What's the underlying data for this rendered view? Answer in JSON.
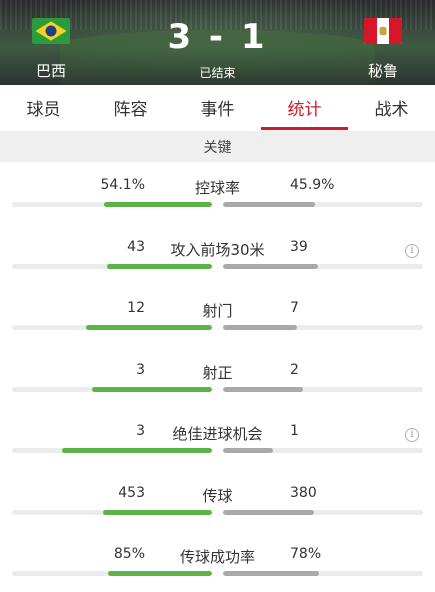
{
  "match": {
    "home_team": "巴西",
    "away_team": "秘鲁",
    "score": "3 - 1",
    "status": "已结束"
  },
  "tabs": [
    {
      "label": "球员"
    },
    {
      "label": "阵容"
    },
    {
      "label": "事件"
    },
    {
      "label": "统计",
      "active": true
    },
    {
      "label": "战术"
    }
  ],
  "section": {
    "title": "关键"
  },
  "stats": [
    {
      "label": "控球率",
      "home": "54.1%",
      "away": "45.9%",
      "home_share": 0.541,
      "away_share": 0.459,
      "info": false
    },
    {
      "label": "攻入前场30米",
      "home": "43",
      "away": "39",
      "home_share": 0.524,
      "away_share": 0.476,
      "info": true
    },
    {
      "label": "射门",
      "home": "12",
      "away": "7",
      "home_share": 0.632,
      "away_share": 0.368,
      "info": false
    },
    {
      "label": "射正",
      "home": "3",
      "away": "2",
      "home_share": 0.6,
      "away_share": 0.4,
      "info": false
    },
    {
      "label": "绝佳进球机会",
      "home": "3",
      "away": "1",
      "home_share": 0.75,
      "away_share": 0.25,
      "info": true
    },
    {
      "label": "传球",
      "home": "453",
      "away": "380",
      "home_share": 0.544,
      "away_share": 0.456,
      "info": false
    },
    {
      "label": "传球成功率",
      "home": "85%",
      "away": "78%",
      "home_share": 0.521,
      "away_share": 0.479,
      "info": false
    }
  ],
  "colors": {
    "accent": "#d6172b",
    "home_bar": "#5cb346",
    "away_bar": "#a9a9ab"
  },
  "icons": {
    "info": "info-icon"
  }
}
